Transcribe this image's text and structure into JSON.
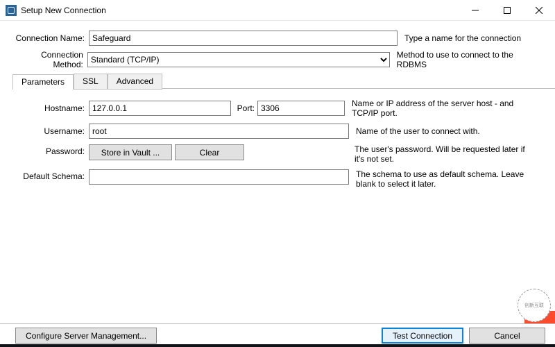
{
  "window": {
    "title": "Setup New Connection"
  },
  "form": {
    "conn_name_label": "Connection Name:",
    "conn_name_value": "Safeguard",
    "conn_name_help": "Type a name for the connection",
    "conn_method_label": "Connection Method:",
    "conn_method_value": "Standard (TCP/IP)",
    "conn_method_help": "Method to use to connect to the RDBMS"
  },
  "tabs": {
    "parameters": "Parameters",
    "ssl": "SSL",
    "advanced": "Advanced",
    "active": "parameters"
  },
  "params": {
    "hostname_label": "Hostname:",
    "hostname_value": "127.0.0.1",
    "port_label": "Port:",
    "port_value": "3306",
    "host_help": "Name or IP address of the server host - and TCP/IP port.",
    "username_label": "Username:",
    "username_value": "root",
    "username_help": "Name of the user to connect with.",
    "password_label": "Password:",
    "store_vault": "Store in Vault ...",
    "clear": "Clear",
    "password_help": "The user's password. Will be requested later if it's not set.",
    "default_schema_label": "Default Schema:",
    "default_schema_value": "",
    "default_schema_help": "The schema to use as default schema. Leave blank to select it later."
  },
  "footer": {
    "configure": "Configure Server Management...",
    "test": "Test Connection",
    "cancel": "Cancel"
  },
  "watermark": "创新互联"
}
